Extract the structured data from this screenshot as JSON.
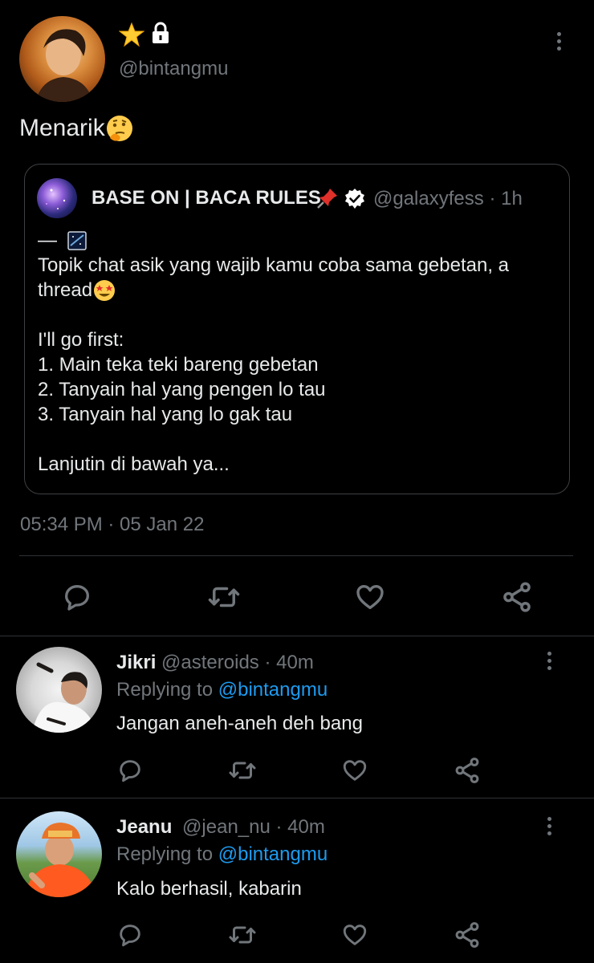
{
  "main_tweet": {
    "badges": [
      "star-emoji",
      "lock-icon"
    ],
    "handle": "@bintangmu",
    "text": "Menarik",
    "timestamp": "05:34 PM · 05 Jan 22"
  },
  "quoted_tweet": {
    "name": "BASE ON | BACA RULES",
    "handle": "@galaxyfess",
    "time": "· 1h",
    "lines": [
      "—",
      "Topik chat asik yang wajib kamu coba sama gebetan, a",
      "thread",
      "I'll go first:",
      "1. Main teka teki bareng gebetan",
      "2. Tanyain hal yang pengen lo tau",
      "3. Tanyain hal yang lo gak tau",
      "Lanjutin di bawah ya..."
    ]
  },
  "replies": [
    {
      "name": "Jikri",
      "handle": "@asteroids",
      "time": "· 40m",
      "replying_to_label": "Replying to",
      "replying_to": "@bintangmu",
      "text": "Jangan aneh-aneh deh bang"
    },
    {
      "name": "Jeanu",
      "handle": "@jean_nu",
      "time": "· 40m",
      "replying_to_label": "Replying to",
      "replying_to": "@bintangmu",
      "text": "Kalo berhasil, kabarin"
    }
  ],
  "colors": {
    "background": "#000000",
    "text": "#e7e9ea",
    "muted": "#71767b",
    "accent": "#1d9bf0",
    "border": "#2f3336"
  }
}
